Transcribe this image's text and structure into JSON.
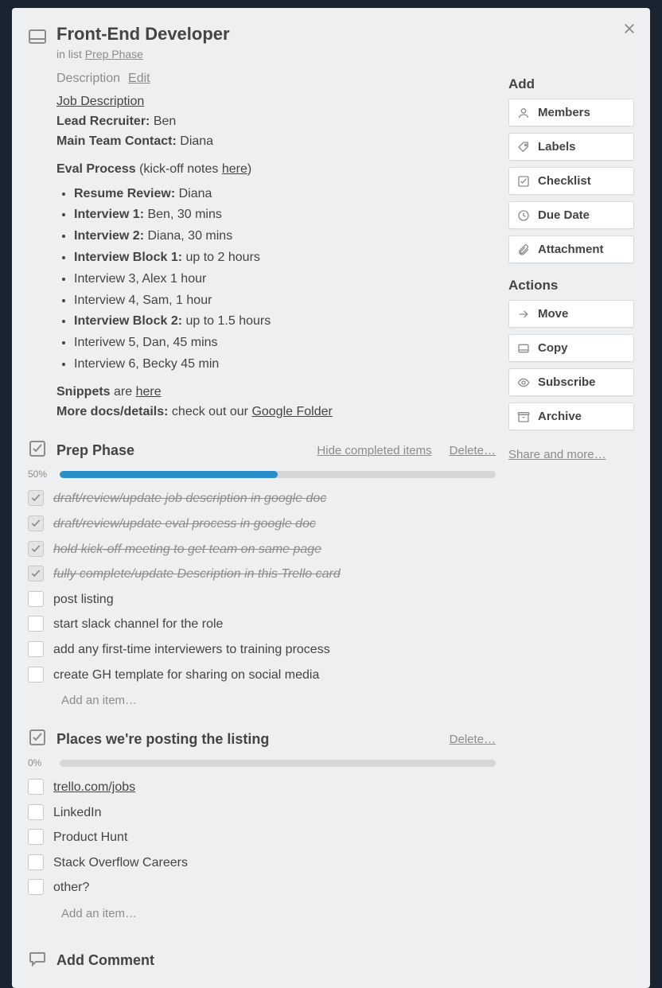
{
  "card": {
    "title": "Front-End Developer",
    "list_prefix": "in list ",
    "list_name": "Prep Phase"
  },
  "description": {
    "heading": "Description",
    "edit": "Edit",
    "job_desc_link": "Job Description",
    "lead_recruiter_label": "Lead Recruiter:",
    "lead_recruiter_value": " Ben",
    "main_contact_label": "Main Team Contact:",
    "main_contact_value": " Diana",
    "eval_label": "Eval Process",
    "eval_note_prefix": " (kick-off notes ",
    "eval_note_link": "here",
    "eval_note_suffix": ")",
    "bullets": [
      {
        "bold": "Resume Review:",
        "rest": " Diana"
      },
      {
        "bold": "Interview 1:",
        "rest": " Ben, 30 mins"
      },
      {
        "bold": "Interview 2:",
        "rest": " Diana, 30 mins"
      },
      {
        "bold": "Interview Block 1:",
        "rest": " up to 2 hours"
      },
      {
        "bold": "",
        "rest": "Interview 3, Alex 1 hour"
      },
      {
        "bold": "",
        "rest": "Interview 4, Sam, 1 hour"
      },
      {
        "bold": "Interview Block 2:",
        "rest": " up to 1.5 hours"
      },
      {
        "bold": "",
        "rest": "Interivew 5, Dan, 45 mins"
      },
      {
        "bold": "",
        "rest": "Interview 6, Becky 45 min"
      }
    ],
    "snippets_label": "Snippets",
    "snippets_are": " are ",
    "snippets_link": "here",
    "more_docs_label": "More docs/details:",
    "more_docs_text": " check out our ",
    "more_docs_link": "Google Folder"
  },
  "checklists": [
    {
      "title": "Prep Phase",
      "percent": "50%",
      "fill": 50,
      "hide_label": "Hide completed items",
      "delete_label": "Delete…",
      "items": [
        {
          "done": true,
          "text": "draft/review/update job description in google doc"
        },
        {
          "done": true,
          "text": "draft/review/update eval process in google doc"
        },
        {
          "done": true,
          "text": "hold kick-off meeting to get team on same page"
        },
        {
          "done": true,
          "text": "fully complete/update Description in this Trello card"
        },
        {
          "done": false,
          "text": "post listing"
        },
        {
          "done": false,
          "text": "start slack channel for the role"
        },
        {
          "done": false,
          "text": "add any first-time interviewers to training process"
        },
        {
          "done": false,
          "text": "create GH template for sharing on social media"
        }
      ],
      "add_item": "Add an item…"
    },
    {
      "title": "Places we're posting the listing",
      "percent": "0%",
      "fill": 0,
      "hide_label": "",
      "delete_label": "Delete…",
      "items": [
        {
          "done": false,
          "text": "trello.com/jobs",
          "link": true
        },
        {
          "done": false,
          "text": "LinkedIn"
        },
        {
          "done": false,
          "text": "Product Hunt"
        },
        {
          "done": false,
          "text": "Stack Overflow Careers"
        },
        {
          "done": false,
          "text": "other?"
        }
      ],
      "add_item": "Add an item…"
    }
  ],
  "comment": {
    "title": "Add Comment"
  },
  "sidebar": {
    "add_heading": "Add",
    "actions_heading": "Actions",
    "add_buttons": [
      {
        "icon": "user",
        "label": "Members"
      },
      {
        "icon": "tag",
        "label": "Labels"
      },
      {
        "icon": "check",
        "label": "Checklist"
      },
      {
        "icon": "clock",
        "label": "Due Date"
      },
      {
        "icon": "clip",
        "label": "Attachment"
      }
    ],
    "action_buttons": [
      {
        "icon": "arrow",
        "label": "Move"
      },
      {
        "icon": "card",
        "label": "Copy"
      },
      {
        "icon": "eye",
        "label": "Subscribe"
      },
      {
        "icon": "box",
        "label": "Archive"
      }
    ],
    "share_link": "Share and more…"
  }
}
